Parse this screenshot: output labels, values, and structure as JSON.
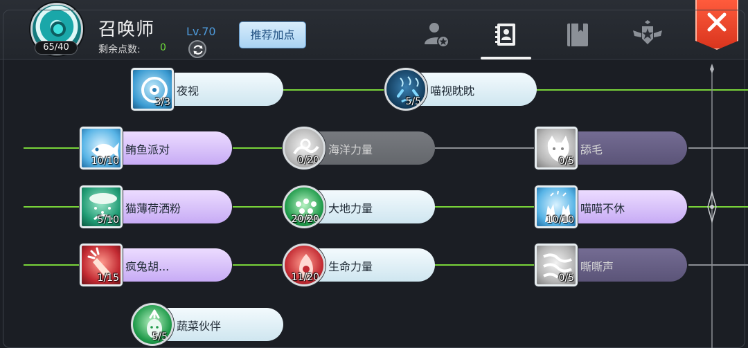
{
  "header": {
    "emblem_counter": "65/40",
    "class_title": "召唤师",
    "points_label": "剩余点数:",
    "points_value": "0",
    "level": "Lv.70",
    "recommend_label": "推荐加点",
    "tabs": [
      {
        "name": "player-profile-tab",
        "icon": "person-star-icon",
        "active": false
      },
      {
        "name": "contacts-book-tab",
        "icon": "contact-book-icon",
        "active": true
      },
      {
        "name": "bookmark-book-tab",
        "icon": "bookmarked-book-icon",
        "active": false
      },
      {
        "name": "rank-badge-tab",
        "icon": "winged-star-badge-icon",
        "active": false
      }
    ],
    "close_icon": "close-x-icon"
  },
  "colors": {
    "active_line": "#7ad63a",
    "inactive_line": "#8c8f94",
    "close_button": "#e5432a",
    "level_text": "#4e9bdc"
  },
  "skills": [
    {
      "name": "夜视",
      "count": "3/3",
      "icon": "clock-eye-icon"
    },
    {
      "name": "喵视眈眈",
      "count": "5/5",
      "icon": "angry-cat-face-icon"
    },
    {
      "name": "鲔鱼派对",
      "count": "10/10",
      "icon": "tuna-fish-icon"
    },
    {
      "name": "海洋力量",
      "count": "0/20",
      "icon": "sea-swirl-icon"
    },
    {
      "name": "舔毛",
      "count": "0/5",
      "icon": "cat-grooming-icon"
    },
    {
      "name": "猫薄荷洒粉",
      "count": "5/10",
      "icon": "catnip-sprinkle-icon"
    },
    {
      "name": "大地力量",
      "count": "20/20",
      "icon": "earth-sprouts-icon"
    },
    {
      "name": "喵喵不休",
      "count": "10/10",
      "icon": "cats-chatter-icon"
    },
    {
      "name": "疯兔胡...",
      "count": "1/15",
      "icon": "crazy-carrot-icon"
    },
    {
      "name": "生命力量",
      "count": "11/20",
      "icon": "life-spirit-icon"
    },
    {
      "name": "嘶嘶声",
      "count": "0/5",
      "icon": "hissing-cat-icon"
    },
    {
      "name": "蔬菜伙伴",
      "count": "5/5",
      "icon": "vegetable-buddy-icon"
    }
  ]
}
